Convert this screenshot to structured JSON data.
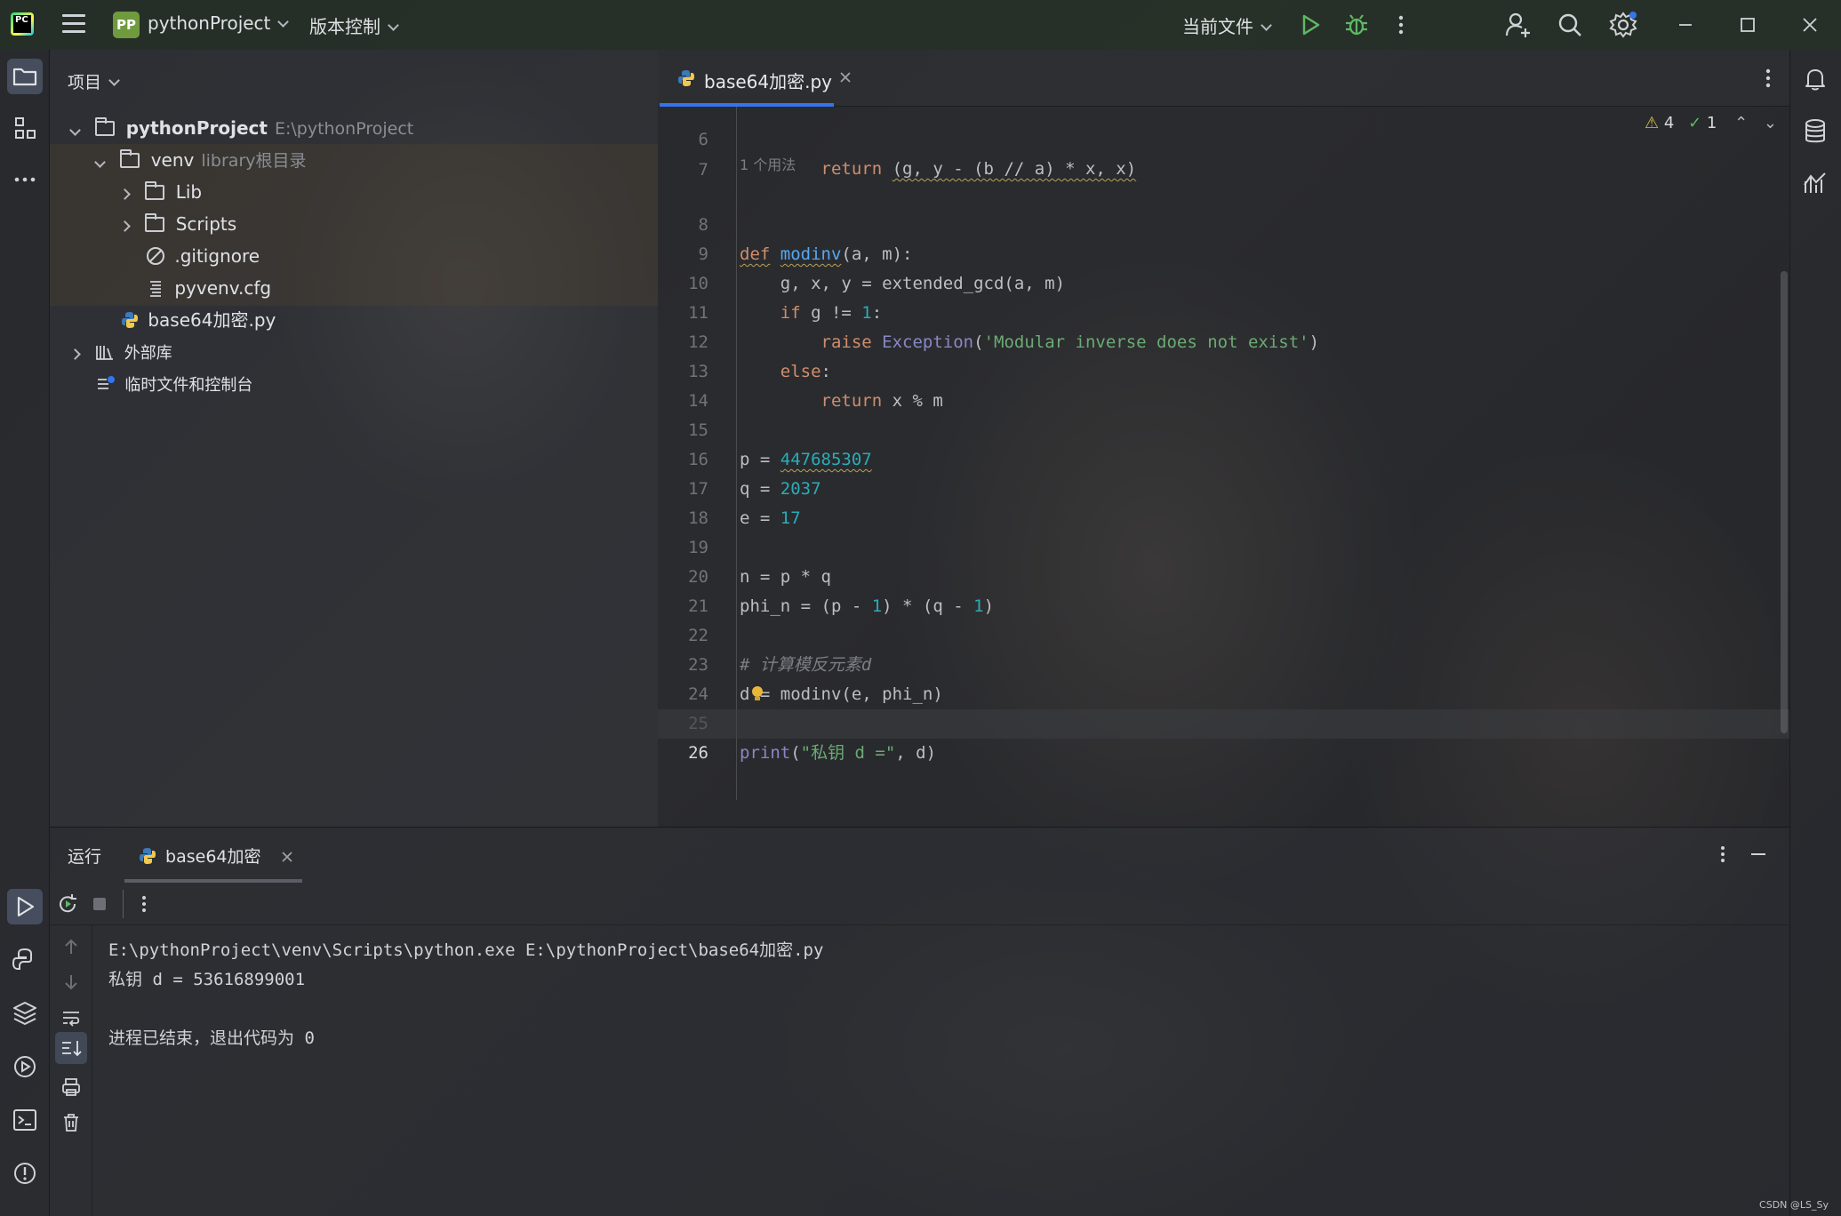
{
  "titlebar": {
    "project_badge": "PP",
    "project_name": "pythonProject",
    "vcs_menu": "版本控制",
    "run_config": "当前文件"
  },
  "project_panel": {
    "title": "项目",
    "tree": [
      {
        "label": "pythonProject",
        "hint": "E:\\pythonProject"
      },
      {
        "label": "venv",
        "hint": "library根目录"
      },
      {
        "label": "Lib"
      },
      {
        "label": "Scripts"
      },
      {
        "label": ".gitignore"
      },
      {
        "label": "pyvenv.cfg"
      },
      {
        "label": "base64加密.py"
      },
      {
        "label": "外部库"
      },
      {
        "label": "临时文件和控制台"
      }
    ]
  },
  "editor": {
    "tab_label": "base64加密.py",
    "inspections": {
      "warnings": "4",
      "ok": "1"
    },
    "usage_hint": "1 个用法",
    "lines": [
      {
        "n": "6",
        "text": "        return (g, y - (b // a) * x, x)"
      },
      {
        "n": "7",
        "text": ""
      },
      {
        "n": "8",
        "text": "def modinv(a, m):"
      },
      {
        "n": "9",
        "text": "    g, x, y = extended_gcd(a, m)"
      },
      {
        "n": "10",
        "text": "    if g != 1:"
      },
      {
        "n": "11",
        "text": "        raise Exception('Modular inverse does not exist')"
      },
      {
        "n": "12",
        "text": "    else:"
      },
      {
        "n": "13",
        "text": "        return x % m"
      },
      {
        "n": "14",
        "text": ""
      },
      {
        "n": "15",
        "text": "p = 447685307"
      },
      {
        "n": "16",
        "text": "q = 2037"
      },
      {
        "n": "17",
        "text": "e = 17"
      },
      {
        "n": "18",
        "text": ""
      },
      {
        "n": "19",
        "text": "n = p * q"
      },
      {
        "n": "20",
        "text": "phi_n = (p - 1) * (q - 1)"
      },
      {
        "n": "21",
        "text": ""
      },
      {
        "n": "22",
        "text": "# 计算模反元素d"
      },
      {
        "n": "23",
        "text": "d = modinv(e, phi_n)"
      },
      {
        "n": "24",
        "text": ""
      },
      {
        "n": "25",
        "text": "print(\"私钥 d =\", d)"
      },
      {
        "n": "26",
        "text": ""
      }
    ]
  },
  "run_panel": {
    "title": "运行",
    "tab_label": "base64加密",
    "console": [
      "E:\\pythonProject\\venv\\Scripts\\python.exe E:\\pythonProject\\base64加密.py",
      "私钥 d = 53616899001",
      "",
      "进程已结束，退出代码为 0"
    ]
  },
  "watermark": "CSDN @LS_Sy",
  "colors": {
    "accent": "#3574f0",
    "keyword": "#cf8e6d",
    "function": "#56a8f5",
    "number": "#2aacb8",
    "string": "#6aab73",
    "comment": "#7a7e85"
  }
}
